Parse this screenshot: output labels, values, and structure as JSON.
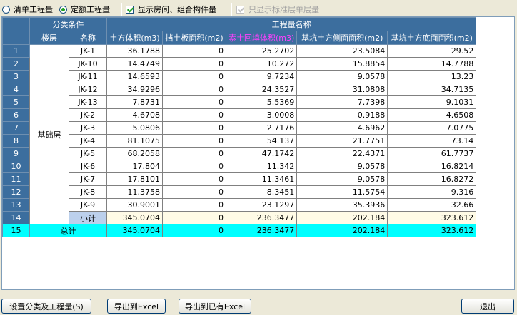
{
  "options": {
    "bill_qty": "清单工程量",
    "quota_qty": "定额工程量",
    "show_rooms": "显示房间、组合构件量",
    "only_std_floor": "只显示标准层单层量"
  },
  "headers": {
    "group_category": "分类条件",
    "group_qty": "工程量名称",
    "floor": "楼层",
    "name": "名称",
    "columns": [
      "土方体积(m3)",
      "挡土板面积(m2)",
      "素土回填体积(m3)",
      "基坑土方侧面面积(m2)",
      "基坑土方底面面积(m2)"
    ]
  },
  "floor_label": "基础层",
  "rows": [
    {
      "n": "1",
      "name": "JK-1",
      "v": [
        "36.1788",
        "0",
        "25.2702",
        "23.5084",
        "29.52"
      ]
    },
    {
      "n": "2",
      "name": "JK-10",
      "v": [
        "14.4749",
        "0",
        "10.272",
        "15.8854",
        "14.7788"
      ]
    },
    {
      "n": "3",
      "name": "JK-11",
      "v": [
        "14.6593",
        "0",
        "9.7234",
        "9.0578",
        "13.23"
      ]
    },
    {
      "n": "4",
      "name": "JK-12",
      "v": [
        "34.9296",
        "0",
        "24.3527",
        "31.0808",
        "34.7135"
      ]
    },
    {
      "n": "5",
      "name": "JK-13",
      "v": [
        "7.8731",
        "0",
        "5.5369",
        "7.7398",
        "9.1031"
      ]
    },
    {
      "n": "6",
      "name": "JK-2",
      "v": [
        "4.6708",
        "0",
        "3.0008",
        "0.9188",
        "4.6508"
      ]
    },
    {
      "n": "7",
      "name": "JK-3",
      "v": [
        "5.0806",
        "0",
        "2.7176",
        "4.6962",
        "7.0775"
      ]
    },
    {
      "n": "8",
      "name": "JK-4",
      "v": [
        "81.1075",
        "0",
        "54.137",
        "21.7751",
        "73.14"
      ]
    },
    {
      "n": "9",
      "name": "JK-5",
      "v": [
        "68.2058",
        "0",
        "47.1742",
        "22.4371",
        "61.7737"
      ]
    },
    {
      "n": "10",
      "name": "JK-6",
      "v": [
        "17.804",
        "0",
        "11.342",
        "9.0578",
        "16.8214"
      ]
    },
    {
      "n": "11",
      "name": "JK-7",
      "v": [
        "17.8101",
        "0",
        "11.3461",
        "9.0578",
        "16.8272"
      ]
    },
    {
      "n": "12",
      "name": "JK-8",
      "v": [
        "11.3758",
        "0",
        "8.3451",
        "11.5754",
        "9.316"
      ]
    },
    {
      "n": "13",
      "name": "JK-9",
      "v": [
        "30.9001",
        "0",
        "23.1297",
        "35.3936",
        "32.66"
      ]
    }
  ],
  "subtotal": {
    "n": "14",
    "label": "小计",
    "v": [
      "345.0704",
      "0",
      "236.3477",
      "202.184",
      "323.612"
    ]
  },
  "total": {
    "n": "15",
    "label": "总计",
    "v": [
      "345.0704",
      "0",
      "236.3477",
      "202.184",
      "323.612"
    ]
  },
  "buttons": {
    "set_category": "设置分类及工程量(S)",
    "export_excel": "导出到Excel",
    "export_existing": "导出到已有Excel",
    "exit": "退出"
  }
}
